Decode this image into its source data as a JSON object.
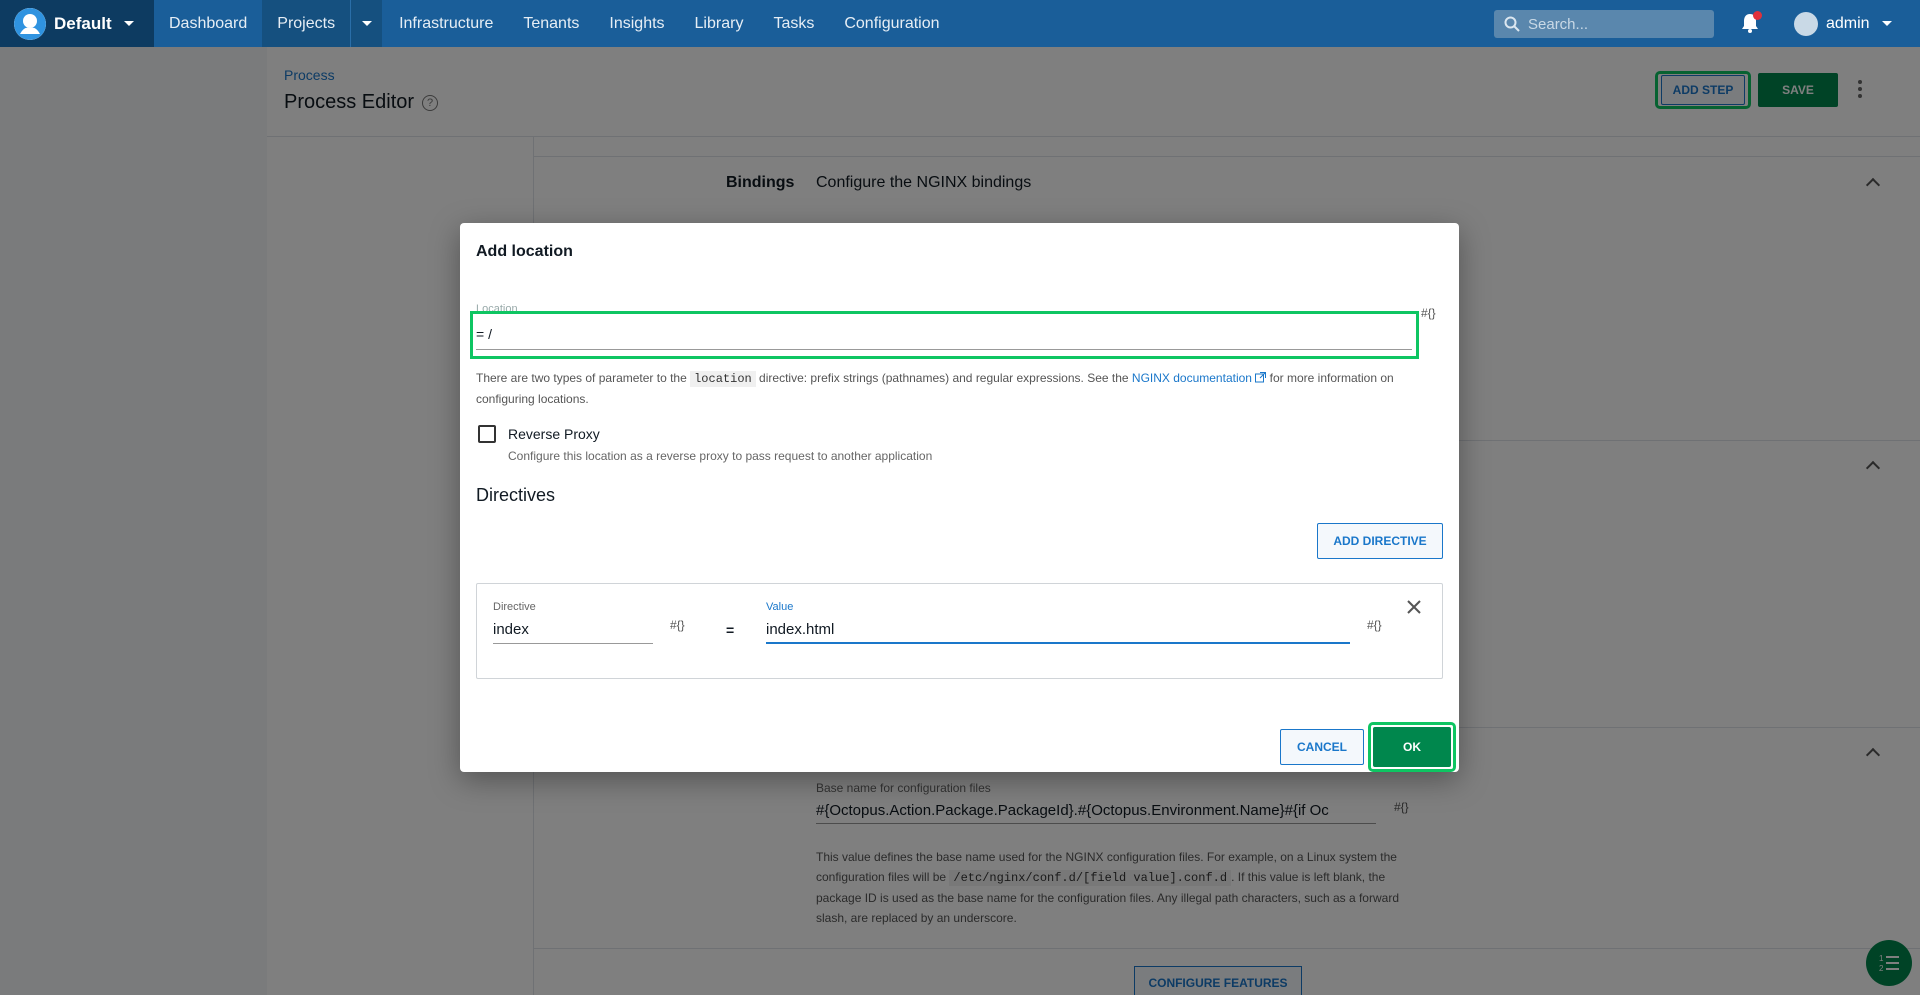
{
  "nav": {
    "space": "Default",
    "items": [
      "Dashboard",
      "Projects",
      "Infrastructure",
      "Tenants",
      "Insights",
      "Library",
      "Tasks",
      "Configuration"
    ],
    "active": "Projects",
    "search_placeholder": "Search...",
    "user": "admin"
  },
  "header": {
    "breadcrumb": "Process",
    "title": "Process Editor",
    "add_step": "ADD STEP",
    "save": "SAVE"
  },
  "background": {
    "bindings_label": "Bindings",
    "bindings_desc": "Configure the NGINX bindings",
    "basename_label": "Base name for configuration files",
    "basename_value": "#{Octopus.Action.Package.PackageId}.#{Octopus.Environment.Name}#{if Oc",
    "basename_help_1": "This value defines the base name used for the NGINX configuration files. For example, on a Linux system the configuration files will be ",
    "basename_help_code": "/etc/nginx/conf.d/[field value].conf.d",
    "basename_help_2": ". If this value is left blank, the package ID is used as the base name for the configuration files. Any illegal path characters, such as a forward slash, are replaced by an underscore.",
    "configure_features": "CONFIGURE FEATURES"
  },
  "dialog": {
    "title": "Add location",
    "location_label": "Location",
    "location_value": "= /",
    "hash_symbol": "#{}",
    "help_1": "There are two types of parameter to the ",
    "help_code": "location",
    "help_2": " directive: prefix strings (pathnames) and regular expressions. See the ",
    "help_link": "NGINX documentation",
    "help_3": " for more information on configuring locations.",
    "reverse_proxy_label": "Reverse Proxy",
    "reverse_proxy_help": "Configure this location as a reverse proxy to pass request to another application",
    "directives_heading": "Directives",
    "add_directive": "ADD DIRECTIVE",
    "directive_label": "Directive",
    "directive_value": "index",
    "equals": "=",
    "value_label": "Value",
    "value_value": "index.html",
    "cancel": "CANCEL",
    "ok": "OK"
  },
  "colors": {
    "nav": "#1a5e99",
    "primary": "#1a77ca",
    "success": "#00874d",
    "highlight": "#0ec562"
  }
}
